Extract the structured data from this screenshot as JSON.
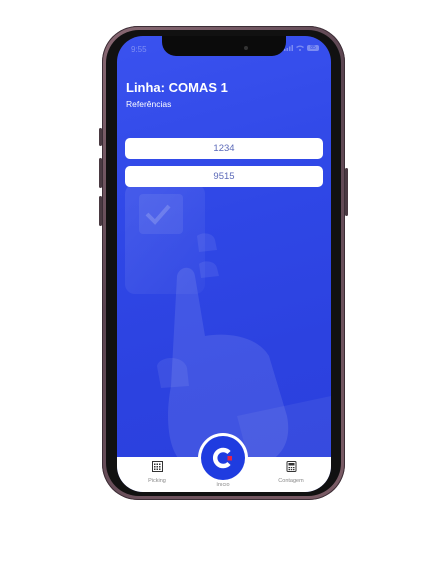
{
  "status": {
    "time": "9:55",
    "battery": "85"
  },
  "header": {
    "title": "Linha: COMAS 1",
    "subtitle": "Referências"
  },
  "references": [
    {
      "code": "1234"
    },
    {
      "code": "9515"
    }
  ],
  "tabbar": {
    "items": [
      {
        "label": "Picking",
        "icon": "barcode-grid-icon"
      },
      {
        "label": "Início",
        "icon": "app-logo-icon"
      },
      {
        "label": "Contagem",
        "icon": "counter-device-icon"
      }
    ]
  },
  "colors": {
    "screen_bg": "#2f47e6",
    "accent_red": "#e6244a",
    "ref_text": "#5b69b8"
  }
}
